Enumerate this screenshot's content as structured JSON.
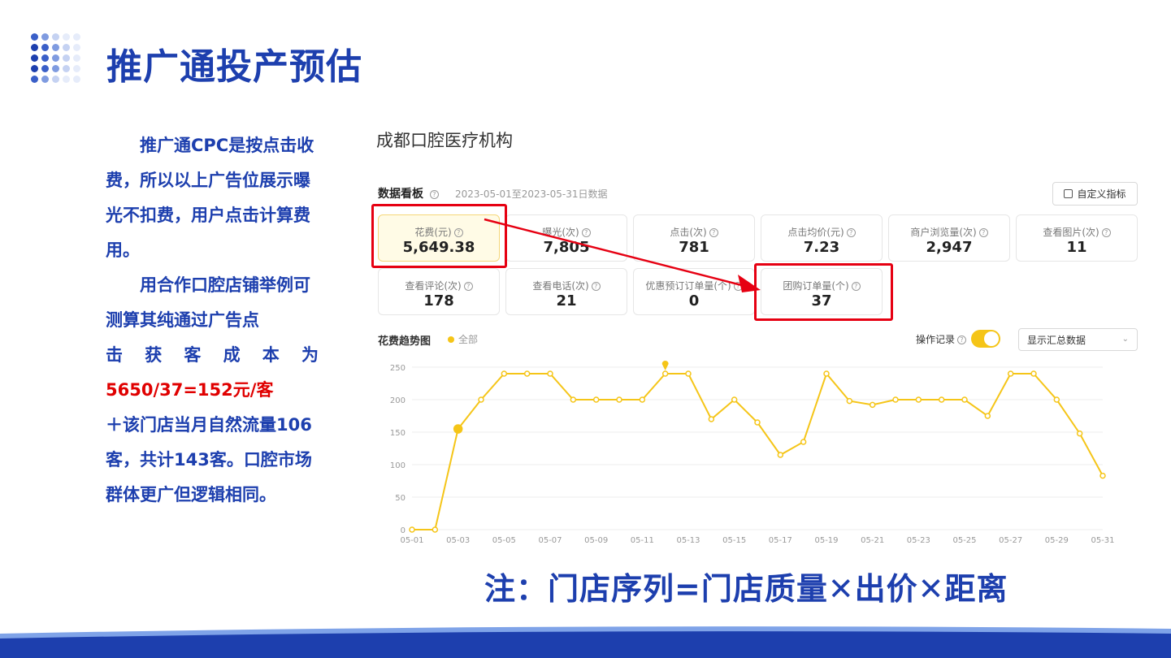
{
  "slide": {
    "title": "推广通投产预估",
    "note": "注：门店序列=门店质量✕出价✕距离"
  },
  "left_text": {
    "p1": "推广通CPC是按点击收费，所以以上广告位展示曝光不扣费，用户点击计算费用。",
    "p2_a": "用合作口腔店铺举例可测算其纯通过广告点",
    "p2_b": "击获客成本为",
    "p2_red": "5650/37=152元/客",
    "p2_c": "＋该门店当月自然流量106客，共计143客。口腔市场群体更广但逻辑相同。"
  },
  "dashboard": {
    "org_name": "成都口腔医疗机构",
    "board_title": "数据看板",
    "date_range": "2023-05-01至2023-05-31日数据",
    "custom_button": "自定义指标",
    "metrics": [
      {
        "label": "花费(元)",
        "value": "5,649.38"
      },
      {
        "label": "曝光(次)",
        "value": "7,805"
      },
      {
        "label": "点击(次)",
        "value": "781"
      },
      {
        "label": "点击均价(元)",
        "value": "7.23"
      },
      {
        "label": "商户浏览量(次)",
        "value": "2,947"
      },
      {
        "label": "查看图片(次)",
        "value": "11"
      },
      {
        "label": "查看评论(次)",
        "value": "178"
      },
      {
        "label": "查看电话(次)",
        "value": "21"
      },
      {
        "label": "优惠预订订单量(个)",
        "value": "0"
      },
      {
        "label": "团购订单量(个)",
        "value": "37"
      }
    ],
    "trend_title": "花费趋势图",
    "legend_label": "全部",
    "op_record_label": "操作记录",
    "display_select": "显示汇总数据"
  },
  "chart_data": {
    "type": "line",
    "x": [
      "05-01",
      "05-02",
      "05-03",
      "05-04",
      "05-05",
      "05-06",
      "05-07",
      "05-08",
      "05-09",
      "05-10",
      "05-11",
      "05-12",
      "05-13",
      "05-14",
      "05-15",
      "05-16",
      "05-17",
      "05-18",
      "05-19",
      "05-20",
      "05-21",
      "05-22",
      "05-23",
      "05-24",
      "05-25",
      "05-26",
      "05-27",
      "05-28",
      "05-29",
      "05-30",
      "05-31"
    ],
    "x_tick_labels": [
      "05-01",
      "05-03",
      "05-05",
      "05-07",
      "05-09",
      "05-11",
      "05-13",
      "05-15",
      "05-17",
      "05-19",
      "05-21",
      "05-23",
      "05-25",
      "05-27",
      "05-29",
      "05-31"
    ],
    "values": [
      0,
      0,
      155,
      200,
      240,
      240,
      240,
      200,
      200,
      200,
      200,
      240,
      240,
      170,
      200,
      165,
      115,
      135,
      240,
      198,
      192,
      200,
      200,
      200,
      200,
      175,
      240,
      240,
      200,
      148,
      83
    ],
    "ylim": [
      0,
      250
    ],
    "y_ticks": [
      0,
      50,
      100,
      150,
      200,
      250
    ],
    "grid": true,
    "color": "#f5c518"
  },
  "colors": {
    "title_blue": "#1d3fae",
    "highlight_red": "#e60012",
    "accent_yellow": "#f5c518"
  }
}
